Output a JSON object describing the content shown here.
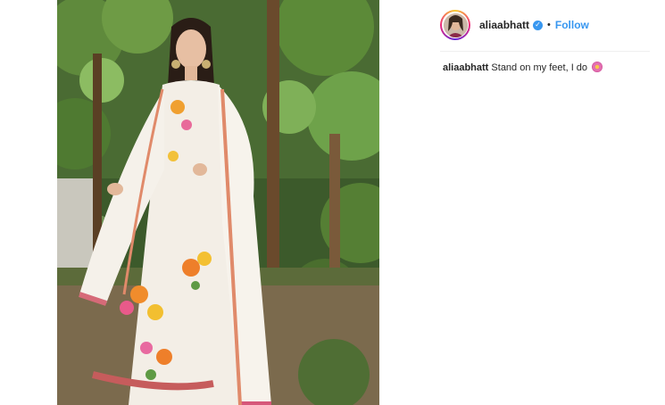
{
  "post": {
    "username": "aliaabhatt",
    "follow_label": "Follow",
    "separator": "•",
    "verified_icon": "verified-badge-icon",
    "caption": {
      "username": "aliaabhatt",
      "text": "Stand on my feet, I do",
      "emoji": "cherry-blossom-emoji"
    }
  },
  "colors": {
    "accent": "#3897f0",
    "text": "#262626"
  }
}
